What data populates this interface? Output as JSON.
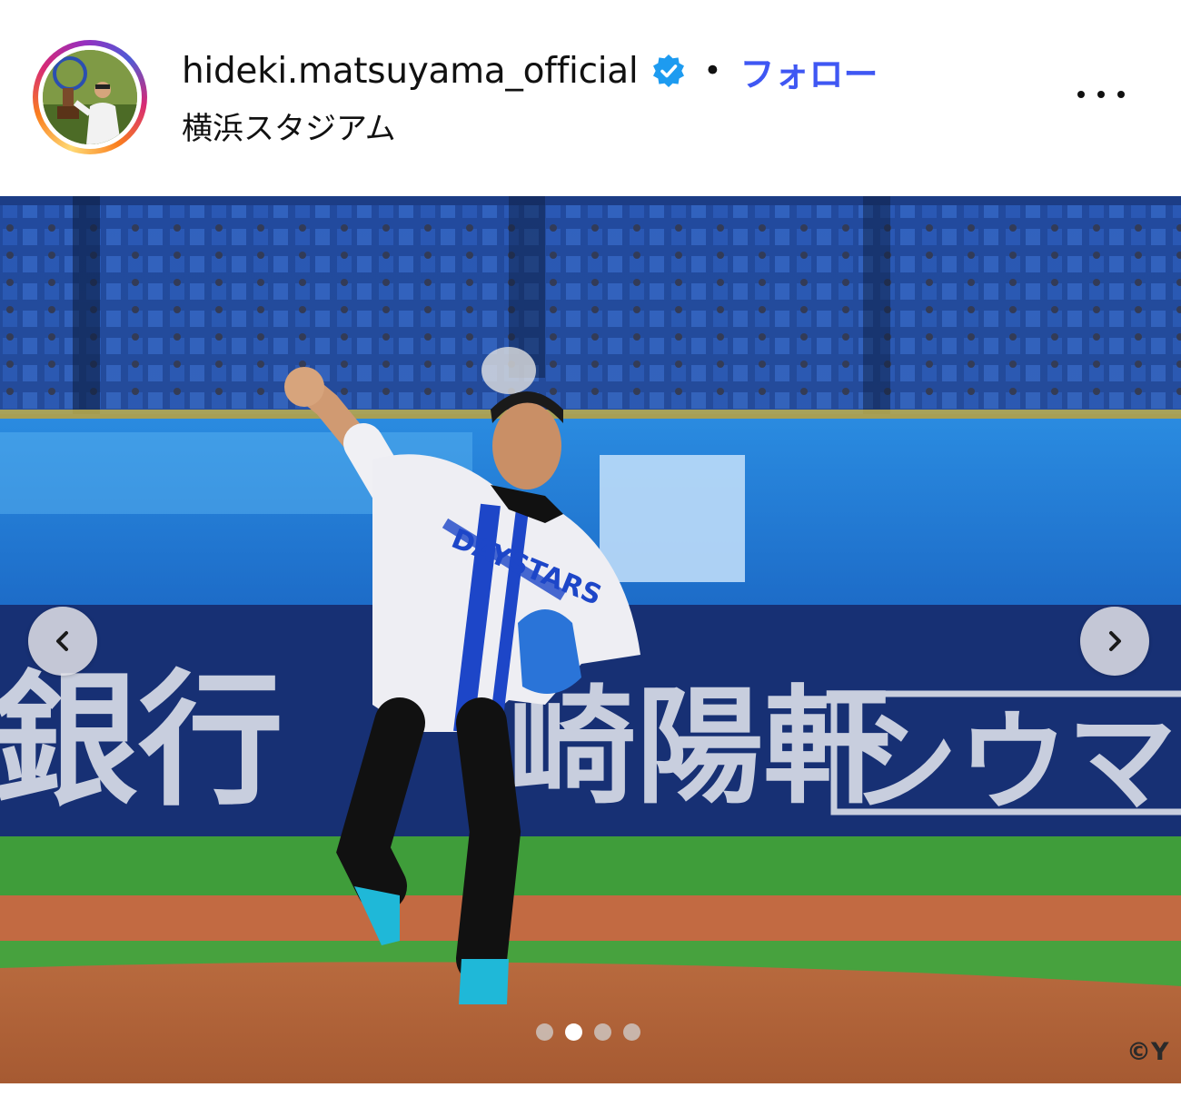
{
  "header": {
    "username": "hideki.matsuyama_official",
    "verified_icon": "verified-badge-icon",
    "separator": "•",
    "follow_label": "フォロー",
    "location": "横浜スタジアム",
    "more_icon": "more-options-icon"
  },
  "photo": {
    "banner_text_left": "銀行",
    "banner_text_mid": "崎陽軒",
    "banner_text_right": "シウマイ",
    "jersey_text": "DAYSTARS",
    "credit": "©Y"
  },
  "carousel": {
    "prev_icon": "chevron-left-icon",
    "next_icon": "chevron-right-icon",
    "total_slides": 4,
    "active_slide": 2
  },
  "colors": {
    "follow_blue": "#3f57f3",
    "verified_blue": "#1d9bf0"
  }
}
